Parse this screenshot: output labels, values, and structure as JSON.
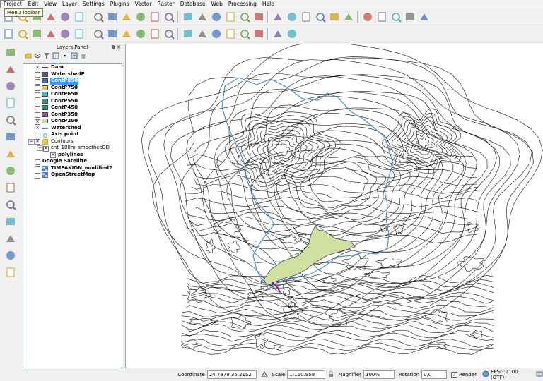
{
  "menu": [
    "Project",
    "Edit",
    "View",
    "Layer",
    "Settings",
    "Plugins",
    "Vector",
    "Raster",
    "Database",
    "Web",
    "Processing",
    "Help"
  ],
  "tooltip": "Menu Toolbar",
  "toolbar1_icons": [
    "new-project-icon",
    "open-project-icon",
    "save-project-icon",
    "save-as-icon",
    "print-composer-icon",
    "composer-manager-icon",
    "pan-icon",
    "pan-to-selection-icon",
    "zoom-in-icon",
    "zoom-out-icon",
    "zoom-native-icon",
    "zoom-full-icon",
    "zoom-to-selection-icon",
    "zoom-to-layer-icon",
    "zoom-last-icon",
    "zoom-next-icon",
    "new-map-view-icon",
    "refresh-icon",
    "identify-icon",
    "measure-icon",
    "select-features-icon",
    "select-by-expression-icon",
    "deselect-icon",
    "attribute-table-icon",
    "statistics-icon",
    "measure-line-icon",
    "annotation-icon",
    "text-annotation-icon",
    "map-tips-icon"
  ],
  "toolbar2_icons": [
    "current-edits-icon",
    "toggle-editing-icon",
    "save-edits-icon",
    "add-feature-icon",
    "move-feature-icon",
    "node-tool-icon",
    "delete-selected-icon",
    "cut-features-icon",
    "copy-features-icon",
    "paste-features-icon",
    "label-icon",
    "pin-labels-icon",
    "diagram-icon",
    "show-hide-labels-icon",
    "move-label-icon",
    "rotate-label-icon",
    "change-label-icon",
    "csw-icon",
    "metasearch-icon",
    "python-console-icon"
  ],
  "left_toolbar_icons": [
    "gps-icon",
    "add-vector-icon",
    "add-raster-icon",
    "add-postgis-icon",
    "add-spatialite-icon",
    "add-mssql-icon",
    "add-wms-icon",
    "add-wcs-icon",
    "add-wfs-icon",
    "add-delimited-text-icon",
    "new-shapefile-icon",
    "new-spatialite-icon",
    "add-virtual-layer-icon",
    "add-oracle-icon"
  ],
  "layers_panel": {
    "title": "Layers Panel",
    "layers": [
      {
        "name": "Dam",
        "checked": true,
        "symbol": "line",
        "color": "#8b1a8b"
      },
      {
        "name": "WatershedP",
        "checked": false,
        "symbol": "fill",
        "color": "#5a5a8a"
      },
      {
        "name": "ContP850",
        "checked": false,
        "symbol": "fill",
        "color": "#3d6db5",
        "selected": true
      },
      {
        "name": "ContP750",
        "checked": false,
        "symbol": "fill",
        "color": "#e6c83a"
      },
      {
        "name": "ContP650",
        "checked": false,
        "symbol": "fill",
        "color": "#2fb8d0"
      },
      {
        "name": "ContP550",
        "checked": false,
        "symbol": "fill",
        "color": "#3a8f8f"
      },
      {
        "name": "ContP450",
        "checked": false,
        "symbol": "fill",
        "color": "#2a9a6a"
      },
      {
        "name": "ContP350",
        "checked": false,
        "symbol": "fill",
        "color": "#a04ab0"
      },
      {
        "name": "ContP250",
        "checked": true,
        "symbol": "fill",
        "color": "#cfe0a0"
      },
      {
        "name": "Watershed",
        "checked": true,
        "symbol": "line",
        "color": "#4a90c8"
      },
      {
        "name": "Axis point",
        "checked": false,
        "symbol": "point",
        "color": "#4a90c8"
      }
    ],
    "group": {
      "name": "Contours",
      "checked": true
    },
    "sub": {
      "name": "cnt_100m_smoothed3D",
      "checked": true
    },
    "subsub": {
      "name": "polylines"
    },
    "bottom_layers": [
      {
        "name": "Google Satellite",
        "checked": false
      },
      {
        "name": "TIMPAKION_modified2",
        "checked": false
      },
      {
        "name": "OpenStreetMap",
        "checked": false
      }
    ]
  },
  "status": {
    "coordinate_label": "Coordinate",
    "coordinate": "24.7379,35.2152",
    "scale_label": "Scale",
    "scale": "1:110.959",
    "magnifier_label": "Magnifier",
    "magnifier": "100%",
    "rotation_label": "Rotation",
    "rotation": "0,0",
    "render_label": "Render",
    "crs": "EPSG:2100 (OTF)"
  },
  "colors": {
    "selection": "#3399ff",
    "watershed": "#4a90c8",
    "dam": "#8b1a8b",
    "reservoir": "#cfe0a0"
  }
}
